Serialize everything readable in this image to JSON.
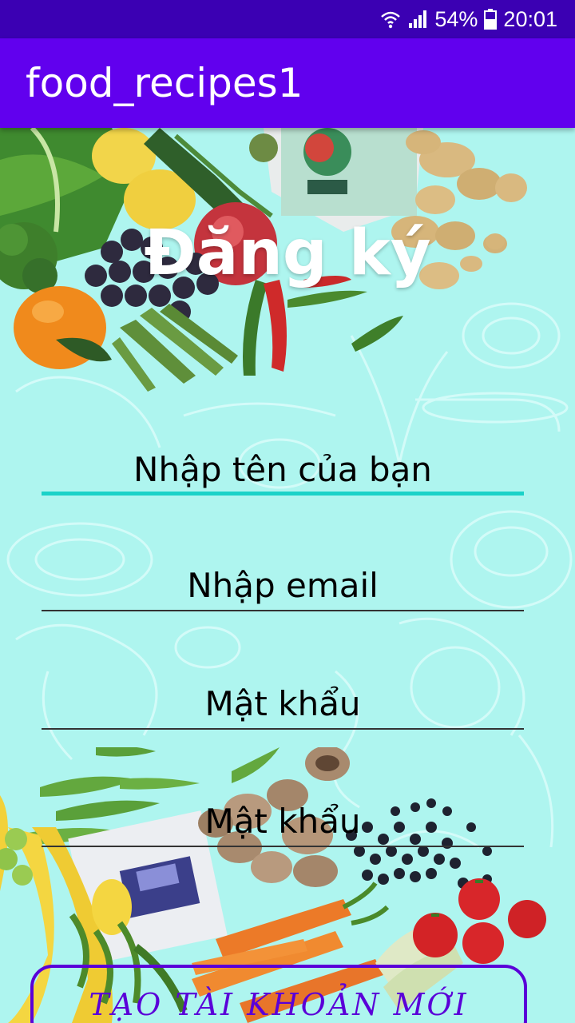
{
  "status_bar": {
    "battery": "54%",
    "time": "20:01"
  },
  "app_bar": {
    "title": "food_recipes1"
  },
  "form": {
    "title": "Đăng ký",
    "name_field": "Nhập tên của bạn",
    "email_field": "Nhập email",
    "password_field": "Mật khẩu",
    "confirm_password_field": "Mật khẩu",
    "create_button": "TẠO TÀI KHOẢN MỚI"
  },
  "colors": {
    "status_bar": "#3b00b3",
    "app_bar": "#6100ee",
    "background": "#aef5ef",
    "focus_line": "#1ad2c8",
    "button": "#5a00d8"
  }
}
